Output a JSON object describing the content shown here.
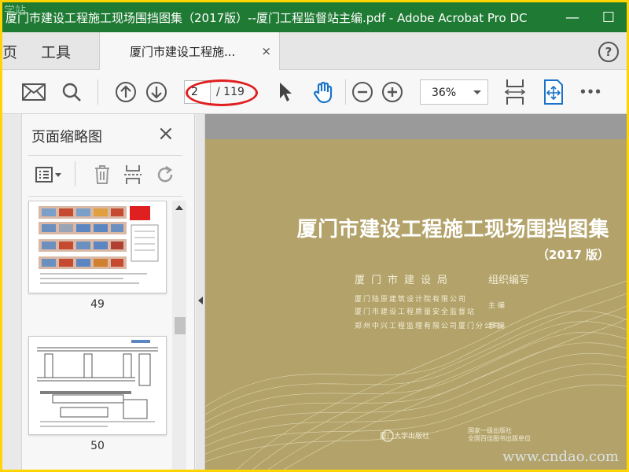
{
  "window": {
    "title": "厦门市建设工程施工现场围挡图集（2017版）--厦门工程监督站主编.pdf - Adobe Acrobat Pro DC",
    "minimize": "—",
    "maximize": "☐"
  },
  "tabs": {
    "home": "页",
    "tools": "工具",
    "document": "厦门市建设工程施...",
    "close": "×",
    "help": "?"
  },
  "toolbar": {
    "current_page": "2",
    "total_pages": "/ 119",
    "zoom": "36%",
    "more": "•••"
  },
  "thumbnails_panel": {
    "title": "页面缩略图",
    "close": "×",
    "pages": [
      {
        "label": "49"
      },
      {
        "label": "50"
      }
    ]
  },
  "cover": {
    "title": "厦门市建设工程施工现场围挡图集",
    "edition": "（2017 版）",
    "org": "厦门市建设局",
    "org_role": "组织编写",
    "editors": [
      {
        "name": "厦门陆原建筑设计院有限公司",
        "role": ""
      },
      {
        "name": "厦门市建设工程质量安全监督站",
        "role": "主  编"
      },
      {
        "name": "郑州中兴工程监理有限公司厦门分公司",
        "role": "参  编"
      }
    ],
    "publisher": "厦门大学出版社",
    "publisher_sub": "国家一级出版社\n全国百佳图书出版单位"
  },
  "watermarks": {
    "bottom_right": "www.cndao.com",
    "top_left": "学站"
  },
  "colors": {
    "titlebar": "#1f7a34",
    "cover_bg": "#b3a36a",
    "highlight": "#e02020",
    "accent_blue": "#1a73c8"
  }
}
